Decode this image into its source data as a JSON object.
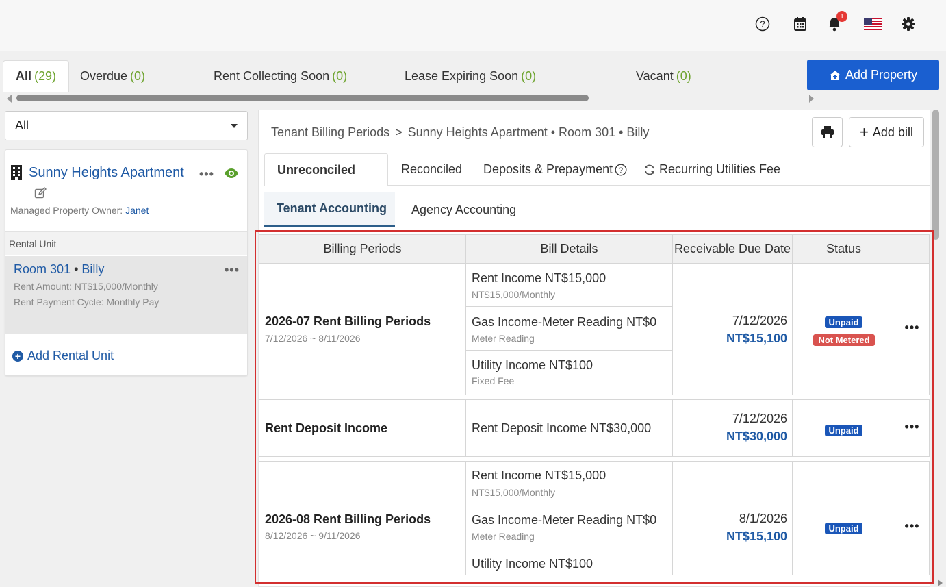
{
  "topbar": {
    "icons": [
      "help-icon",
      "calendar-icon",
      "bell-icon",
      "us-flag-icon",
      "gear-icon"
    ],
    "notification_count": "1"
  },
  "filters": {
    "tabs": [
      {
        "label": "All",
        "count": "(29)"
      },
      {
        "label": "Overdue",
        "count": "(0)"
      },
      {
        "label": "Rent Collecting Soon",
        "count": "(0)"
      },
      {
        "label": "Lease Expiring Soon",
        "count": "(0)"
      },
      {
        "label": "Vacant",
        "count": "(0)"
      }
    ],
    "add_property_label": "Add Property"
  },
  "left": {
    "select_value": "All",
    "property_name": "Sunny Heights Apartment",
    "owner_label": "Managed Property Owner:",
    "owner_name": "Janet",
    "rental_unit_header": "Rental Unit",
    "unit_room": "Room 301",
    "unit_sep": "•",
    "unit_tenant": "Billy",
    "rent_amount": "Rent Amount: NT$15,000/Monthly",
    "rent_cycle": "Rent Payment Cycle: Monthly Pay",
    "add_unit_label": "Add Rental Unit"
  },
  "main": {
    "breadcrumb_root": "Tenant Billing Periods",
    "breadcrumb_sep": ">",
    "breadcrumb_current": "Sunny Heights Apartment • Room 301 • Billy",
    "add_bill_label": "Add bill",
    "tabs": [
      "Unreconciled",
      "Reconciled",
      "Deposits & Prepayment",
      "Recurring Utilities Fee"
    ],
    "subtabs": [
      "Tenant Accounting",
      "Agency Accounting"
    ],
    "table": {
      "headers": [
        "Billing Periods",
        "Bill Details",
        "Receivable Due Date",
        "Status"
      ],
      "rows": [
        {
          "period": "2026-07 Rent Billing Periods",
          "range": "7/12/2026 ~ 8/11/2026",
          "details": [
            {
              "name": "Rent Income  NT$15,000",
              "sub": "NT$15,000/Monthly"
            },
            {
              "name": "Gas Income-Meter Reading  NT$0",
              "sub": "Meter Reading"
            },
            {
              "name": "Utility Income  NT$100",
              "sub": "Fixed Fee"
            }
          ],
          "due_date": "7/12/2026",
          "due_amount": "NT$15,100",
          "status": [
            "Unpaid",
            "Not Metered"
          ]
        },
        {
          "period": "Rent Deposit Income",
          "details": [
            {
              "name": "Rent Deposit Income  NT$30,000"
            }
          ],
          "due_date": "7/12/2026",
          "due_amount": "NT$30,000",
          "status": [
            "Unpaid"
          ]
        },
        {
          "period": "2026-08 Rent Billing Periods",
          "range": "8/12/2026 ~ 9/11/2026",
          "details": [
            {
              "name": "Rent Income  NT$15,000",
              "sub": "NT$15,000/Monthly"
            },
            {
              "name": "Gas Income-Meter Reading  NT$0",
              "sub": "Meter Reading"
            },
            {
              "name": "Utility Income  NT$100"
            }
          ],
          "due_date": "8/1/2026",
          "due_amount": "NT$15,100",
          "status": [
            "Unpaid"
          ]
        }
      ]
    }
  },
  "colors": {
    "accent": "#1a5fd0",
    "link": "#1f5aa5",
    "count_green": "#6ea42f",
    "eye_green": "#5aa02c",
    "highlight_border": "#d32f2f",
    "unpaid_badge": "#1a56b8",
    "not_metered_badge": "#d9534f"
  }
}
